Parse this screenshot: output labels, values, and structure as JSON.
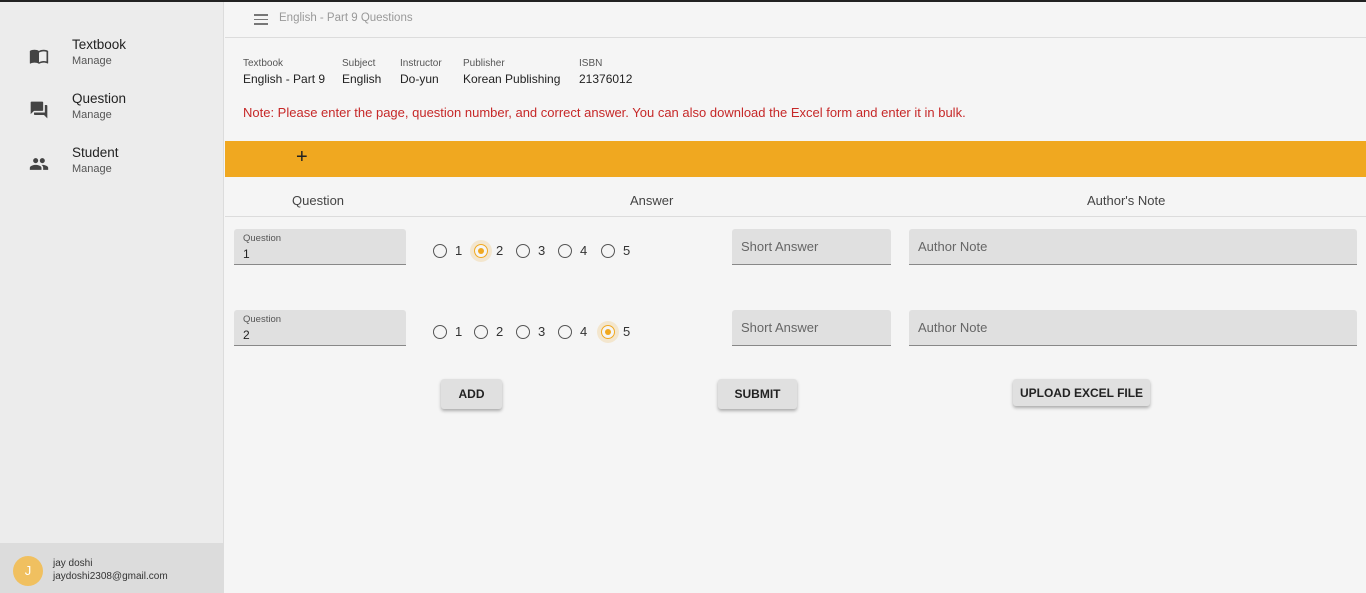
{
  "sidebar": {
    "items": [
      {
        "title": "Textbook",
        "sub": "Manage",
        "icon": "book-icon"
      },
      {
        "title": "Question",
        "sub": "Manage",
        "icon": "forum-icon"
      },
      {
        "title": "Student",
        "sub": "Manage",
        "icon": "people-icon"
      }
    ],
    "user": {
      "initial": "J",
      "name": "jay doshi",
      "email": "jaydoshi2308@gmail.com"
    }
  },
  "header": {
    "title": "English - Part 9 Questions"
  },
  "info": [
    {
      "label": "Textbook",
      "value": "English - Part 9"
    },
    {
      "label": "Subject",
      "value": "English"
    },
    {
      "label": "Instructor",
      "value": "Do-yun"
    },
    {
      "label": "Publisher",
      "value": "Korean Publishing"
    },
    {
      "label": "ISBN",
      "value": "21376012"
    }
  ],
  "note": "Note: Please enter the page, question number, and correct answer. You can also download the Excel form and enter it in bulk.",
  "toolbar": {
    "add_symbol": "+"
  },
  "columns": {
    "question": "Question",
    "answer": "Answer",
    "note": "Author's Note"
  },
  "rows": [
    {
      "label": "Question",
      "value": "1",
      "options": [
        "1",
        "2",
        "3",
        "4",
        "5"
      ],
      "selected": "2",
      "short_placeholder": "Short Answer",
      "note_placeholder": "Author Note"
    },
    {
      "label": "Question",
      "value": "2",
      "options": [
        "1",
        "2",
        "3",
        "4",
        "5"
      ],
      "selected": "5",
      "short_placeholder": "Short Answer",
      "note_placeholder": "Author Note"
    }
  ],
  "buttons": {
    "add": "ADD",
    "submit": "SUBMIT",
    "upload": "UPLOAD EXCEL FILE"
  },
  "colors": {
    "accent": "#f0a820",
    "note_red": "#c62828",
    "avatar": "#f0c060"
  }
}
